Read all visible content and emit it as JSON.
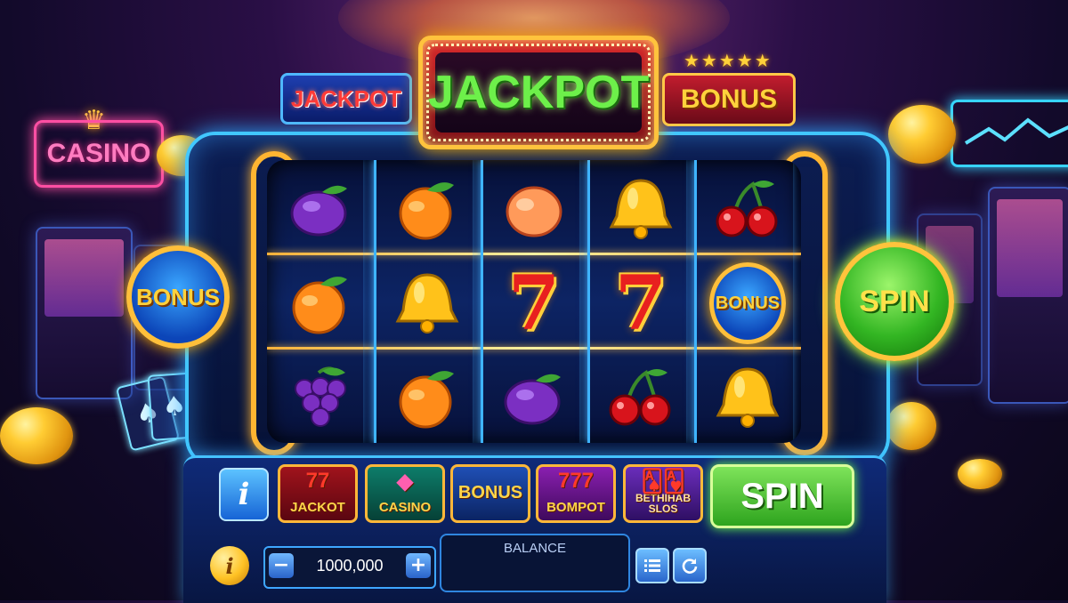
{
  "signs": {
    "jackpot_small": "JACKPOT",
    "jackpot_main": "JACKPOT",
    "bonus_top": "BONUS",
    "stars": "★★★★★",
    "neon_casino": "CASINO"
  },
  "reels": [
    [
      "plum",
      "orange",
      "grapes"
    ],
    [
      "orange",
      "bell",
      "orange"
    ],
    [
      "peach",
      "seven",
      "plum"
    ],
    [
      "bell",
      "seven",
      "cherry"
    ],
    [
      "cherry",
      "bonus",
      "bell"
    ]
  ],
  "symbols": {
    "seven": "7",
    "bonus": "BONUS"
  },
  "side_buttons": {
    "left_bonus": "BONUS",
    "spin": "SPIN"
  },
  "game_tiles": [
    {
      "label": "JACKOT",
      "icon": "77",
      "color_from": "#a0131c",
      "color_to": "#5a0610"
    },
    {
      "label": "CASINO",
      "icon": "◆",
      "color_from": "#0d7d6a",
      "color_to": "#064136"
    },
    {
      "label": "BONUS",
      "icon": "",
      "color_from": "#1f4fb5",
      "color_to": "#0b2463"
    },
    {
      "label": "BOMPOT",
      "icon": "777",
      "color_from": "#8a1fb0",
      "color_to": "#3f0a5c"
    },
    {
      "label": "BETHIHAB SLOS",
      "icon": "🂡🂱",
      "color_from": "#6a2dbb",
      "color_to": "#2f0f63"
    }
  ],
  "controls": {
    "info_label": "i",
    "spin_label": "SPIN",
    "bet_value": "1000,000",
    "minus": "−",
    "plus": "+",
    "balance_label": "BALANCE",
    "info_coin": "i"
  },
  "colors": {
    "frame_neon": "#41c7ff",
    "gold": "#ffbf3a",
    "spin_green": "#33b623"
  }
}
